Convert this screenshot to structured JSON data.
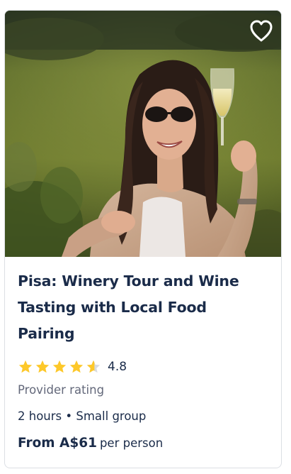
{
  "card": {
    "image_alt": "Woman in sunglasses raising a glass of white wine in a vineyard",
    "wishlist_icon": "heart-outline-icon",
    "title": "Pisa: Winery Tour and Wine Tasting with Local Food Pairing",
    "rating": {
      "stars": 4.8,
      "value": "4.8",
      "label": "Provider rating",
      "star_color": "#fdc82a"
    },
    "duration": "2 hours",
    "separator": "•",
    "group": "Small group",
    "price": "From A$61",
    "price_suffix": "per person"
  },
  "colors": {
    "text": "#1a2b49",
    "muted": "#63687a",
    "border": "#dcdfe4"
  }
}
